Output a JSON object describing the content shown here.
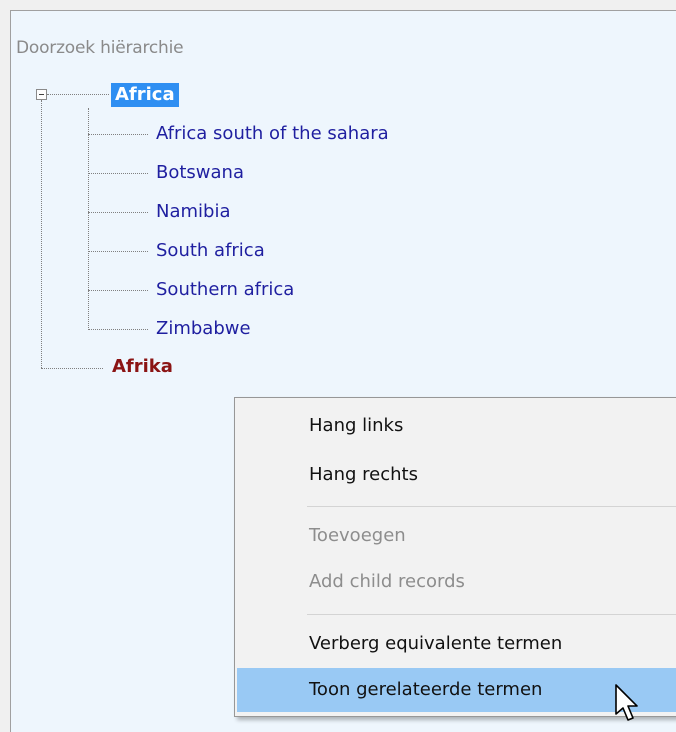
{
  "panel": {
    "title": "Doorzoek hiërarchie"
  },
  "tree": {
    "root": {
      "label": "Africa",
      "selected": true,
      "expanded": true
    },
    "children": [
      {
        "label": "Africa south of the sahara"
      },
      {
        "label": "Botswana"
      },
      {
        "label": "Namibia"
      },
      {
        "label": "South africa"
      },
      {
        "label": "Southern africa"
      },
      {
        "label": "Zimbabwe"
      }
    ],
    "second_root": {
      "label": "Afrika"
    }
  },
  "context_menu": {
    "items": [
      {
        "label": "Hang links",
        "enabled": true
      },
      {
        "label": "Hang rechts",
        "enabled": true
      },
      {
        "label": "Toevoegen",
        "enabled": false
      },
      {
        "label": "Add child records",
        "enabled": false
      },
      {
        "label": "Verberg equivalente termen",
        "enabled": true
      },
      {
        "label": "Toon gerelateerde termen",
        "enabled": true,
        "highlighted": true
      }
    ]
  },
  "colors": {
    "panel_bg": "#eef6fd",
    "selection": "#2f8ff2",
    "tree_link": "#1f1fa0",
    "second_root": "#8b1414",
    "menu_highlight": "#99c9f4"
  },
  "icons": {
    "cursor": "arrow-cursor-icon",
    "expander": "minus-expander-icon"
  }
}
